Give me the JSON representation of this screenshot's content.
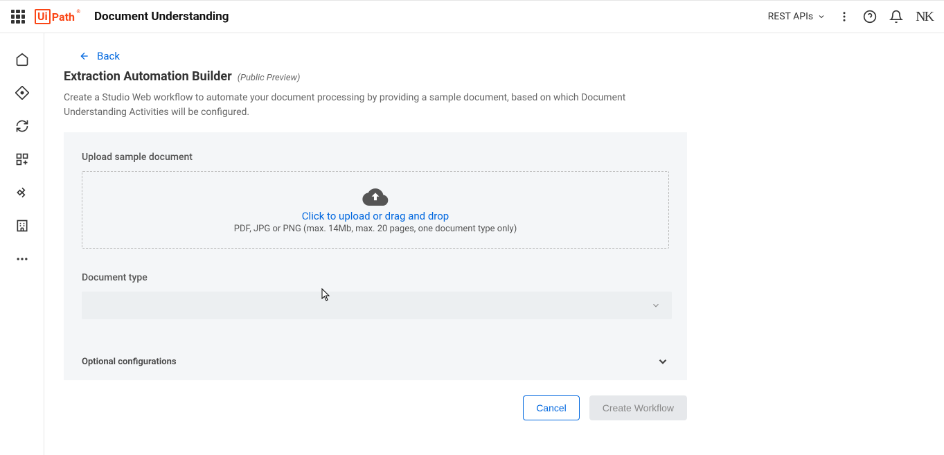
{
  "header": {
    "product": "Document Understanding",
    "rest_apis": "REST APIs",
    "avatar": "NK"
  },
  "main": {
    "back_label": "Back",
    "title": "Extraction Automation Builder",
    "preview_label": "(Public Preview)",
    "description": "Create a Studio Web workflow to automate your document processing by providing a sample document, based on which Document Understanding Activities will be configured."
  },
  "upload": {
    "section_label": "Upload sample document",
    "cta": "Click to upload or drag and drop",
    "hint": "PDF, JPG or PNG (max. 14Mb, max. 20 pages, one document type only)"
  },
  "doctype": {
    "label": "Document type"
  },
  "optional": {
    "label": "Optional configurations"
  },
  "footer": {
    "cancel": "Cancel",
    "create": "Create Workflow"
  }
}
